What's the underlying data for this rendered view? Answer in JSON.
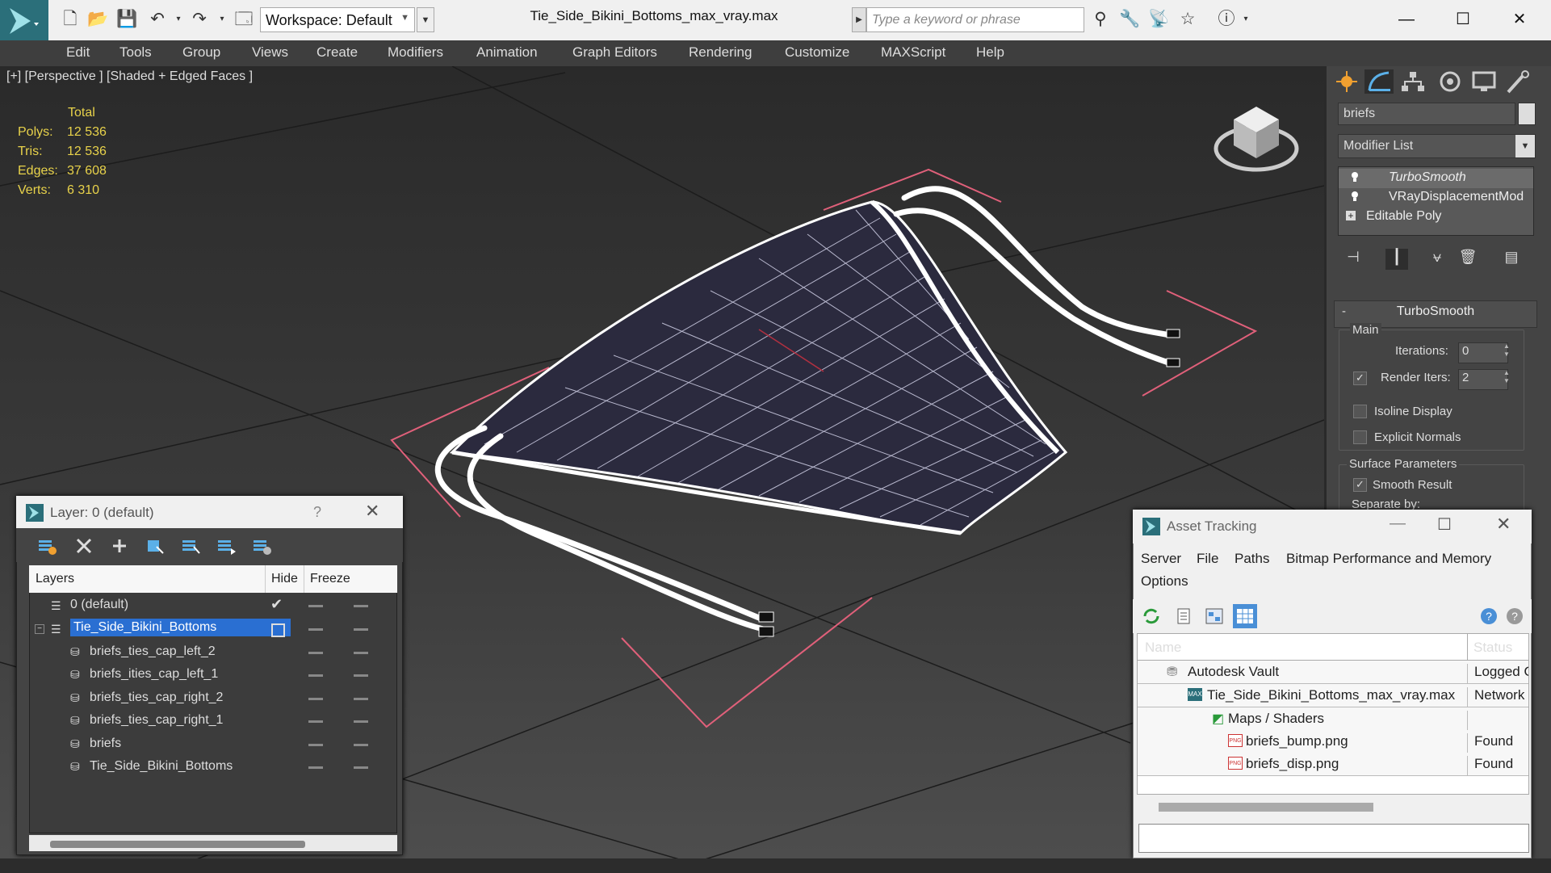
{
  "app": {
    "title": "Tie_Side_Bikini_Bottoms_max_vray.max",
    "workspace": "Workspace: Default",
    "search_placeholder": "Type a keyword or phrase",
    "window_controls": [
      "minimize-icon",
      "maximize-icon",
      "close-icon"
    ]
  },
  "menu": [
    "Edit",
    "Tools",
    "Group",
    "Views",
    "Create",
    "Modifiers",
    "Animation",
    "Graph Editors",
    "Rendering",
    "Customize",
    "MAXScript",
    "Help"
  ],
  "viewport": {
    "label": "[+] [Perspective ] [Shaded + Edged Faces ]",
    "stats_header": "Total",
    "stats": [
      {
        "label": "Polys:",
        "value": "12 536"
      },
      {
        "label": "Tris:",
        "value": "12 536"
      },
      {
        "label": "Edges:",
        "value": "37 608"
      },
      {
        "label": "Verts:",
        "value": "6 310"
      }
    ]
  },
  "command_panel": {
    "object_name": "briefs",
    "modifier_list": "Modifier List",
    "stack": [
      "TurboSmooth",
      "VRayDisplacementMod",
      "Editable Poly"
    ],
    "rollout_title": "TurboSmooth",
    "main_group": "Main",
    "iterations_label": "Iterations:",
    "iterations_value": "0",
    "render_iters_label": "Render Iters:",
    "render_iters_value": "2",
    "isoline_label": "Isoline Display",
    "explicit_normals_label": "Explicit Normals",
    "surface_group": "Surface Parameters",
    "smooth_result_label": "Smooth Result",
    "separate_by_label": "Separate by:",
    "rollout_toggle": "-"
  },
  "layer_panel": {
    "title": "Layer: 0 (default)",
    "help": "?",
    "columns": [
      "Layers",
      "Hide",
      "Freeze"
    ],
    "rows": [
      {
        "name": "0 (default)",
        "kind": "layer"
      },
      {
        "name": "Tie_Side_Bikini_Bottoms",
        "kind": "layer",
        "selected": true
      },
      {
        "name": "briefs_ties_cap_left_2",
        "kind": "object"
      },
      {
        "name": "briefs_ities_cap_left_1",
        "kind": "object"
      },
      {
        "name": "briefs_ties_cap_right_2",
        "kind": "object"
      },
      {
        "name": "briefs_ties_cap_right_1",
        "kind": "object"
      },
      {
        "name": "briefs",
        "kind": "object"
      },
      {
        "name": "Tie_Side_Bikini_Bottoms",
        "kind": "object"
      }
    ]
  },
  "asset_tracking": {
    "title": "Asset Tracking",
    "menu": [
      "Server",
      "File",
      "Paths",
      "Bitmap Performance and Memory",
      "Options"
    ],
    "columns": [
      "Name",
      "Status"
    ],
    "rows": [
      {
        "name": "Autodesk Vault",
        "status": "Logged O"
      },
      {
        "name": "Tie_Side_Bikini_Bottoms_max_vray.max",
        "status": "Network F"
      },
      {
        "name": "Maps / Shaders",
        "status": ""
      },
      {
        "name": "briefs_bump.png",
        "status": "Found"
      },
      {
        "name": "briefs_disp.png",
        "status": "Found"
      }
    ]
  },
  "colors": {
    "viewport_top": "#2a2a2a",
    "wireframe": "#ffffff",
    "selection_bracket": "#e0607a",
    "stats_text": "#e8d24a",
    "layer_selected": "#2a6fd2"
  }
}
